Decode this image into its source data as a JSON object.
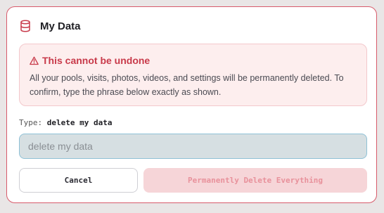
{
  "card": {
    "title": "My Data",
    "icon": "database-icon"
  },
  "warning": {
    "icon": "warning-triangle-icon",
    "title": "This cannot be undone",
    "text": "All your pools, visits, photos, videos, and settings will be permanently deleted. To confirm, type the phrase below exactly as shown."
  },
  "confirm": {
    "type_label": "Type:",
    "phrase": "delete my data",
    "input_placeholder": "delete my data",
    "input_value": ""
  },
  "buttons": {
    "cancel_label": "Cancel",
    "delete_label": "Permanently Delete Everything",
    "delete_disabled": true
  },
  "colors": {
    "accent_red": "#c83a4a",
    "border_red": "#d85a6a",
    "warning_bg": "#fdeeee",
    "input_bg": "#d6dfe2",
    "input_border": "#8fc1d6",
    "delete_disabled_bg": "#f6d5d8",
    "delete_disabled_text": "#e8919b"
  }
}
